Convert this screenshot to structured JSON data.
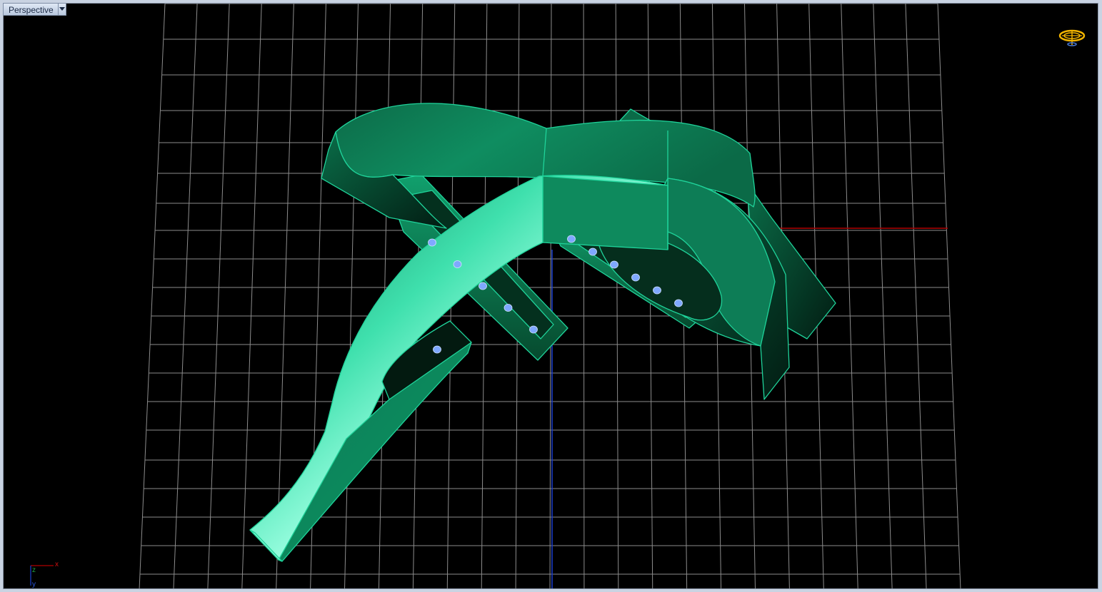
{
  "viewport": {
    "title": "Perspective",
    "view_type": "perspective",
    "display_mode": "shaded",
    "grid_visible": true,
    "world_axes_visible": true
  },
  "axis_indicator": {
    "x_label": "x",
    "y_label": "y",
    "z_label": "z"
  },
  "icons": {
    "viewport_menu": "chevron-down-icon",
    "gumball": "gumball-widget-icon"
  },
  "colors": {
    "background": "#000000",
    "grid": "#8c8c8c",
    "axis_x": "#b00000",
    "axis_y": "#1a3fd0",
    "model_fill": "#0a8a5c",
    "model_edge": "#1fd39a",
    "highlight": "#7fffd9",
    "gem": "#7fa8ff",
    "widget_accent": "#f2b400"
  }
}
